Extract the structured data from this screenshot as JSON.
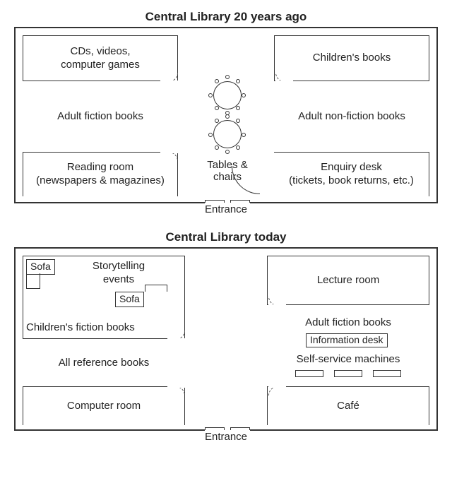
{
  "diagram1": {
    "title": "Central Library 20 years ago",
    "entrance": "Entrance",
    "tables_label": "Tables &\nchairs",
    "rooms": {
      "tl": "CDs, videos,\ncomputer games",
      "tr": "Children's books",
      "ml": "Adult fiction books",
      "mr": "Adult non-fiction books",
      "bl": "Reading room\n(newspapers & magazines)",
      "br": "Enquiry desk\n(tickets, book returns, etc.)"
    }
  },
  "diagram2": {
    "title": "Central Library today",
    "entrance": "Entrance",
    "sofa": "Sofa",
    "info_desk": "Information desk",
    "ssm_label": "Self-service machines",
    "rooms": {
      "tl_upper": "Storytelling\nevents",
      "tl_lower": "Children's fiction books",
      "tr": "Lecture room",
      "ml": "All reference books",
      "mr": "Adult fiction books",
      "bl": "Computer room",
      "br": "Café"
    }
  }
}
